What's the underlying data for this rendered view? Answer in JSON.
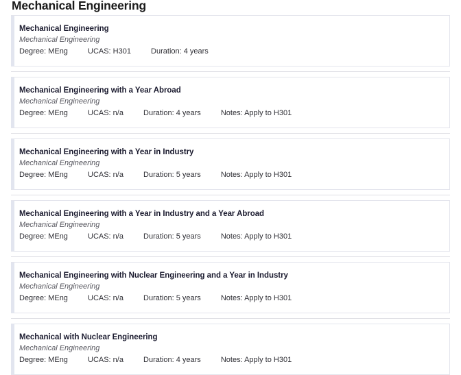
{
  "page": {
    "title": "Mechanical Engineering"
  },
  "labels": {
    "degree": "Degree:",
    "ucas": "UCAS:",
    "duration": "Duration:",
    "notes": "Notes:"
  },
  "courses": [
    {
      "name": "Mechanical Engineering",
      "department": "Mechanical Engineering",
      "degree": "Degree: MEng",
      "ucas": "UCAS: H301",
      "duration": "Duration: 4 years",
      "notes": ""
    },
    {
      "name": "Mechanical Engineering with a Year Abroad",
      "department": "Mechanical Engineering",
      "degree": "Degree: MEng",
      "ucas": "UCAS: n/a",
      "duration": "Duration: 4 years",
      "notes": "Notes: Apply to H301"
    },
    {
      "name": "Mechanical Engineering with a Year in Industry",
      "department": "Mechanical Engineering",
      "degree": "Degree: MEng",
      "ucas": "UCAS: n/a",
      "duration": "Duration: 5 years",
      "notes": "Notes: Apply to H301"
    },
    {
      "name": "Mechanical Engineering with a Year in Industry and a Year Abroad",
      "department": "Mechanical Engineering",
      "degree": "Degree: MEng",
      "ucas": "UCAS: n/a",
      "duration": "Duration: 5 years",
      "notes": "Notes: Apply to H301"
    },
    {
      "name": "Mechanical Engineering with Nuclear Engineering and a Year in Industry",
      "department": "Mechanical Engineering",
      "degree": "Degree: MEng",
      "ucas": "UCAS: n/a",
      "duration": "Duration: 5 years",
      "notes": "Notes: Apply to H301"
    },
    {
      "name": "Mechanical with Nuclear Engineering",
      "department": "Mechanical Engineering",
      "degree": "Degree: MEng",
      "ucas": "UCAS: n/a",
      "duration": "Duration: 4 years",
      "notes": "Notes: Apply to H301"
    }
  ],
  "colors": {
    "accent_bar": "#e2e5ef",
    "card_border": "#e3e4ec",
    "separator": "#dedee4",
    "title_text": "#1a1a2e",
    "dept_text": "#57575f",
    "meta_text": "#2f2f35",
    "background": "#ffffff"
  }
}
